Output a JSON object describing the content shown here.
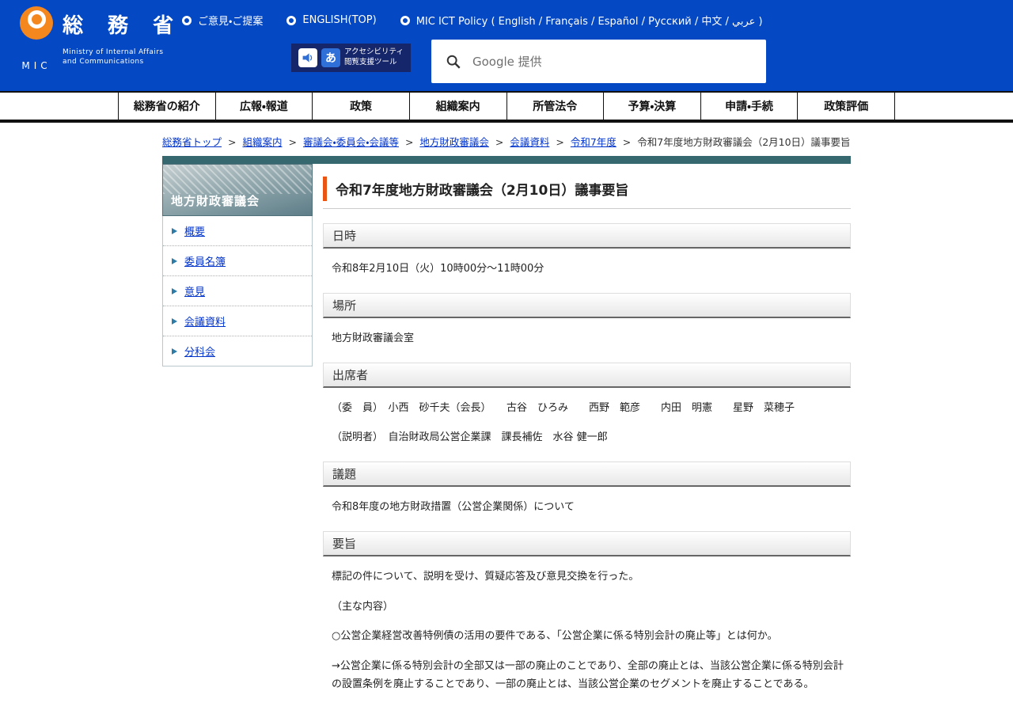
{
  "colors": {
    "header_blue": "#0448c3",
    "logo_orange": "#f5871f",
    "accent_orange": "#ea5514",
    "teal_bar": "#35686f",
    "link_blue": "#0033cc"
  },
  "header": {
    "logo": {
      "org_ja": "総 務 省",
      "org_en_line1": "Ministry of Internal Affairs",
      "org_en_line2": "and Communications",
      "mic": "MIC"
    },
    "links": [
      "ご意見・ご提案",
      "ENGLISH(TOP)",
      "MIC ICT Policy ( English / Français / Español / Русский / 中文 / عربي )"
    ],
    "accessibility": {
      "line1": "アクセシビリティ",
      "line2": "閲覧支援ツール",
      "a_icon": "あ"
    },
    "search": {
      "label": "Google 提供"
    }
  },
  "nav": {
    "items": [
      "総務省の紹介",
      "広報・報道",
      "政策",
      "組織案内",
      "所管法令",
      "予算・決算",
      "申請・手続",
      "政策評価"
    ]
  },
  "breadcrumb": {
    "separator": ">",
    "links": [
      "総務省トップ",
      "組織案内",
      "審議会・委員会・会議等",
      "地方財政審議会",
      "会議資料",
      "令和7年度"
    ],
    "current": "令和7年度地方財政審議会（2月10日）議事要旨"
  },
  "sidebar": {
    "title": "地方財政審議会",
    "items": [
      "概要",
      "委員名簿",
      "意見",
      "会議資料",
      "分科会"
    ]
  },
  "main": {
    "title": "令和7年度地方財政審議会（2月10日）議事要旨",
    "sections": [
      {
        "heading": "日時",
        "paragraphs": [
          "令和8年2月10日（火）10時00分～11時00分"
        ]
      },
      {
        "heading": "場所",
        "paragraphs": [
          "地方財政審議会室"
        ]
      },
      {
        "heading": "出席者",
        "paragraphs": [
          "（委　員）　小西　砂千夫（会長）　　古谷　ひろみ　　西野　範彦　　内田　明憲　　星野　菜穂子",
          "（説明者）　自治財政局公営企業課　課長補佐　水谷 健一郎"
        ]
      },
      {
        "heading": "議題",
        "paragraphs": [
          "令和8年度の地方財政措置（公営企業関係）について"
        ]
      },
      {
        "heading": "要旨",
        "paragraphs": [
          "標記の件について、説明を受け、質疑応答及び意見交換を行った。",
          "（主な内容）",
          "○公営企業経営改善特例債の活用の要件である、「公営企業に係る特別会計の廃止等」とは何か。",
          "→公営企業に係る特別会計の全部又は一部の廃止のことであり、全部の廃止とは、当該公営企業に係る特別会計の設置条例を廃止することであり、一部の廃止とは、当該公営企業のセグメントを廃止することである。"
        ]
      }
    ]
  }
}
